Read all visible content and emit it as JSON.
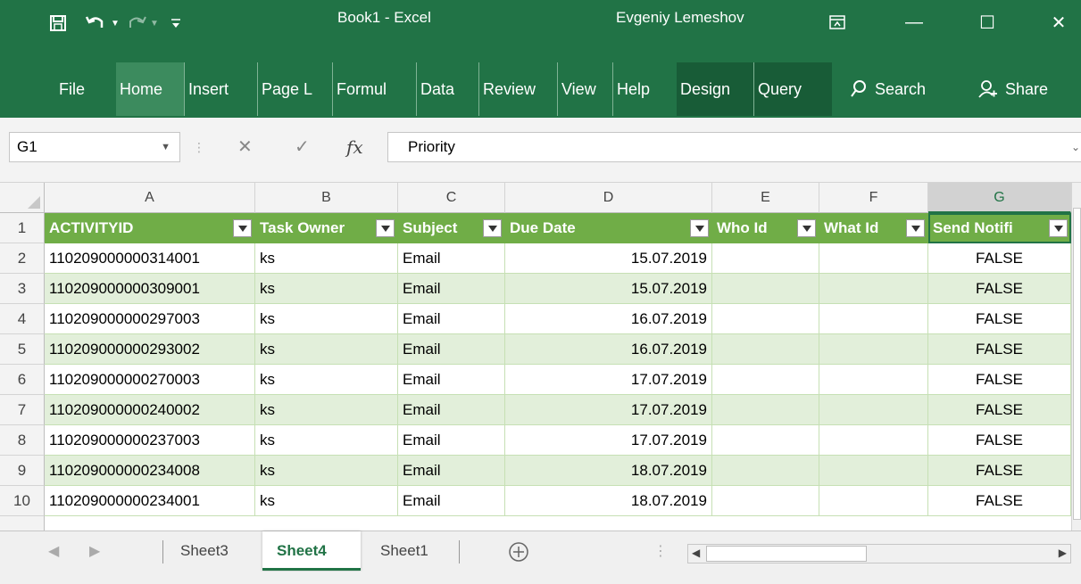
{
  "titlebar": {
    "save_icon": "save-icon",
    "undo_icon": "undo-icon",
    "redo_icon": "redo-icon",
    "customize_icon": "customize-quick-access-icon",
    "title": "Book1 - Excel",
    "user": "Evgeniy Lemeshov",
    "ribbon_display_icon": "ribbon-display-options-icon",
    "minimize": "—",
    "maximize": "☐",
    "close": "✕",
    "color": "#217346"
  },
  "ribbon": {
    "tabs": [
      "File",
      "Home",
      "Insert",
      "Page L",
      "Formul",
      "Data",
      "Review",
      "View",
      "Help",
      "Design",
      "Query"
    ],
    "search_label": "Search",
    "share_label": "Share"
  },
  "formula_bar": {
    "name_box": "G1",
    "cancel_symbol": "✕",
    "enter_symbol": "✓",
    "fx_symbol": "fx",
    "value": "Priority"
  },
  "grid": {
    "columns": [
      "A",
      "B",
      "C",
      "D",
      "E",
      "F",
      "G"
    ],
    "selected_column": "G",
    "headers": [
      "ACTIVITYID",
      "Task Owner",
      "Subject",
      "Due Date",
      "Who Id",
      "What Id",
      "Send Notifi"
    ],
    "rows": [
      {
        "num": "1"
      },
      {
        "num": "2",
        "a": "110209000000314001",
        "b": "ks",
        "c": "Email",
        "d": "15.07.2019",
        "e": "",
        "f": "",
        "g": "FALSE"
      },
      {
        "num": "3",
        "a": "110209000000309001",
        "b": "ks",
        "c": "Email",
        "d": "15.07.2019",
        "e": "",
        "f": "",
        "g": "FALSE"
      },
      {
        "num": "4",
        "a": "110209000000297003",
        "b": "ks",
        "c": "Email",
        "d": "16.07.2019",
        "e": "",
        "f": "",
        "g": "FALSE"
      },
      {
        "num": "5",
        "a": "110209000000293002",
        "b": "ks",
        "c": "Email",
        "d": "16.07.2019",
        "e": "",
        "f": "",
        "g": "FALSE"
      },
      {
        "num": "6",
        "a": "110209000000270003",
        "b": "ks",
        "c": "Email",
        "d": "17.07.2019",
        "e": "",
        "f": "",
        "g": "FALSE"
      },
      {
        "num": "7",
        "a": "110209000000240002",
        "b": "ks",
        "c": "Email",
        "d": "17.07.2019",
        "e": "",
        "f": "",
        "g": "FALSE"
      },
      {
        "num": "8",
        "a": "110209000000237003",
        "b": "ks",
        "c": "Email",
        "d": "17.07.2019",
        "e": "",
        "f": "",
        "g": "FALSE"
      },
      {
        "num": "9",
        "a": "110209000000234008",
        "b": "ks",
        "c": "Email",
        "d": "18.07.2019",
        "e": "",
        "f": "",
        "g": "FALSE"
      },
      {
        "num": "10",
        "a": "110209000000234001",
        "b": "ks",
        "c": "Email",
        "d": "18.07.2019",
        "e": "",
        "f": "",
        "g": "FALSE"
      }
    ],
    "header_color": "#70ad47",
    "band_color": "#e2efda"
  },
  "sheet_tabs": {
    "tabs": [
      "Sheet3",
      "Sheet4",
      "Sheet1"
    ],
    "active": "Sheet4",
    "add_icon": "add-sheet-icon"
  }
}
